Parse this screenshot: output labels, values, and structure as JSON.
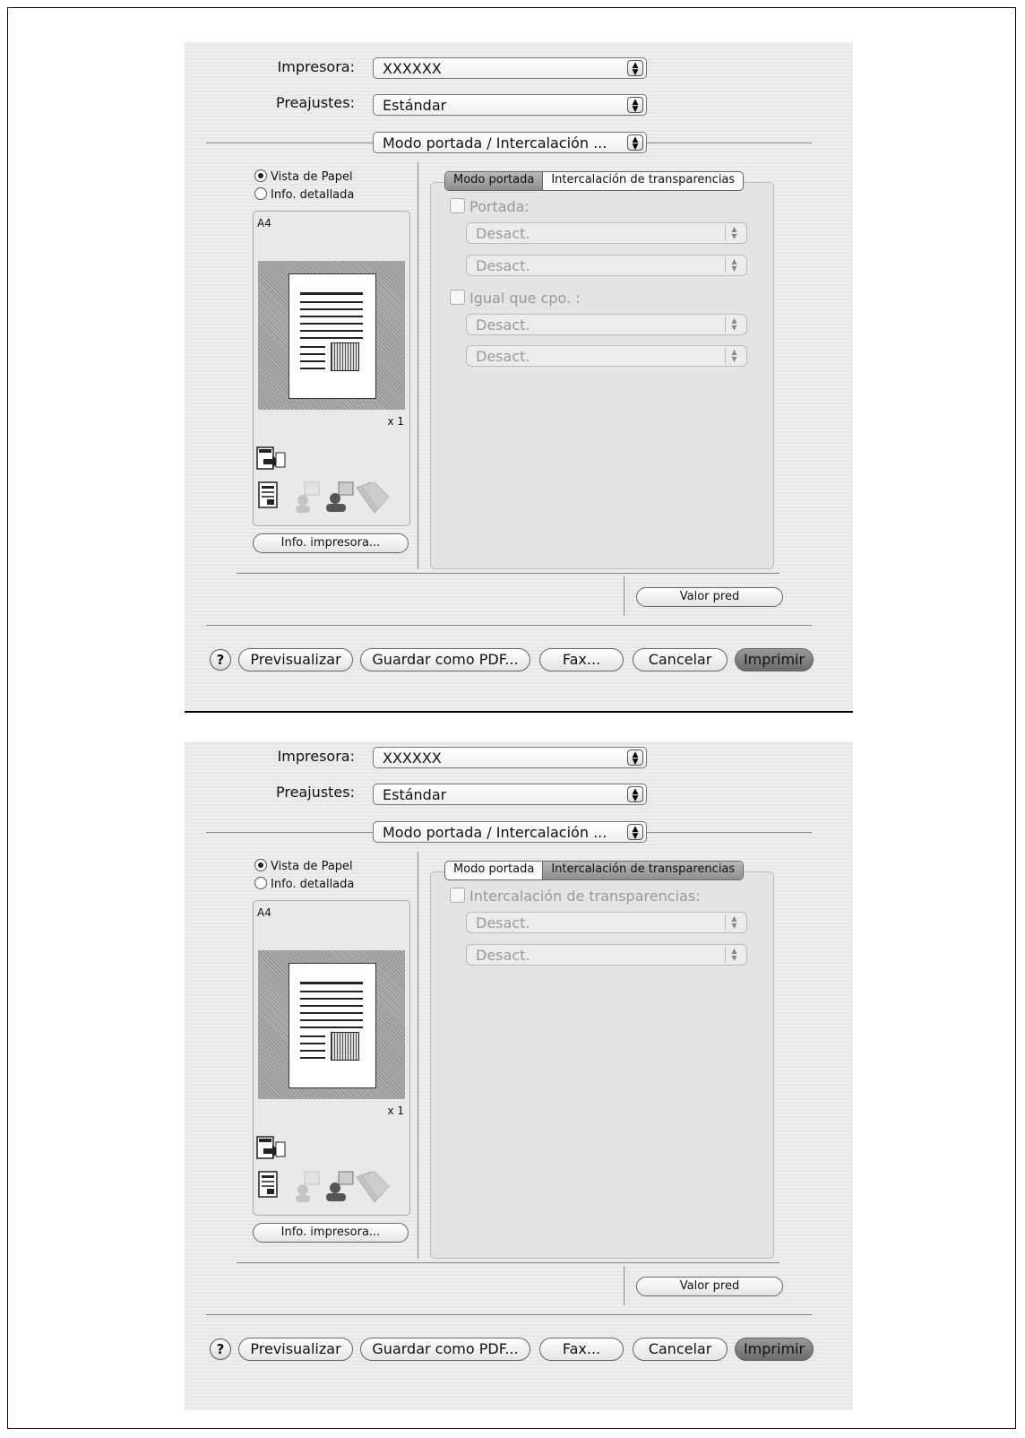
{
  "common": {
    "printer_label": "Impresora:",
    "printer_value": "XXXXXX",
    "presets_label": "Preajustes:",
    "presets_value": "Estándar",
    "panel_value": "Modo portada / Intercalación ...",
    "radio_paper_view": "Vista de Papel",
    "radio_detailed_info": "Info. detallada",
    "paper_size": "A4",
    "copies": "x 1",
    "printer_info_button": "Info. impresora...",
    "default_button": "Valor pred",
    "help_button": "?",
    "preview_button": "Previsualizar",
    "save_pdf_button": "Guardar como PDF...",
    "fax_button": "Fax...",
    "cancel_button": "Cancelar",
    "print_button": "Imprimir",
    "tab_cover": "Modo portada",
    "tab_transparency": "Intercalación de transparencias",
    "arrows_glyph": "▲\n▼"
  },
  "dialog1": {
    "selected_tab": "Modo portada",
    "cover_check_label": "Portada:",
    "cover_select_1": "Desact.",
    "cover_select_2": "Desact.",
    "same_as_body_label": "Igual que cpo. :",
    "body_select_1": "Desact.",
    "body_select_2": "Desact."
  },
  "dialog2": {
    "selected_tab": "Intercalación de transparencias",
    "interleave_check_label": "Intercalación de transparencias:",
    "interleave_select_1": "Desact.",
    "interleave_select_2": "Desact."
  }
}
